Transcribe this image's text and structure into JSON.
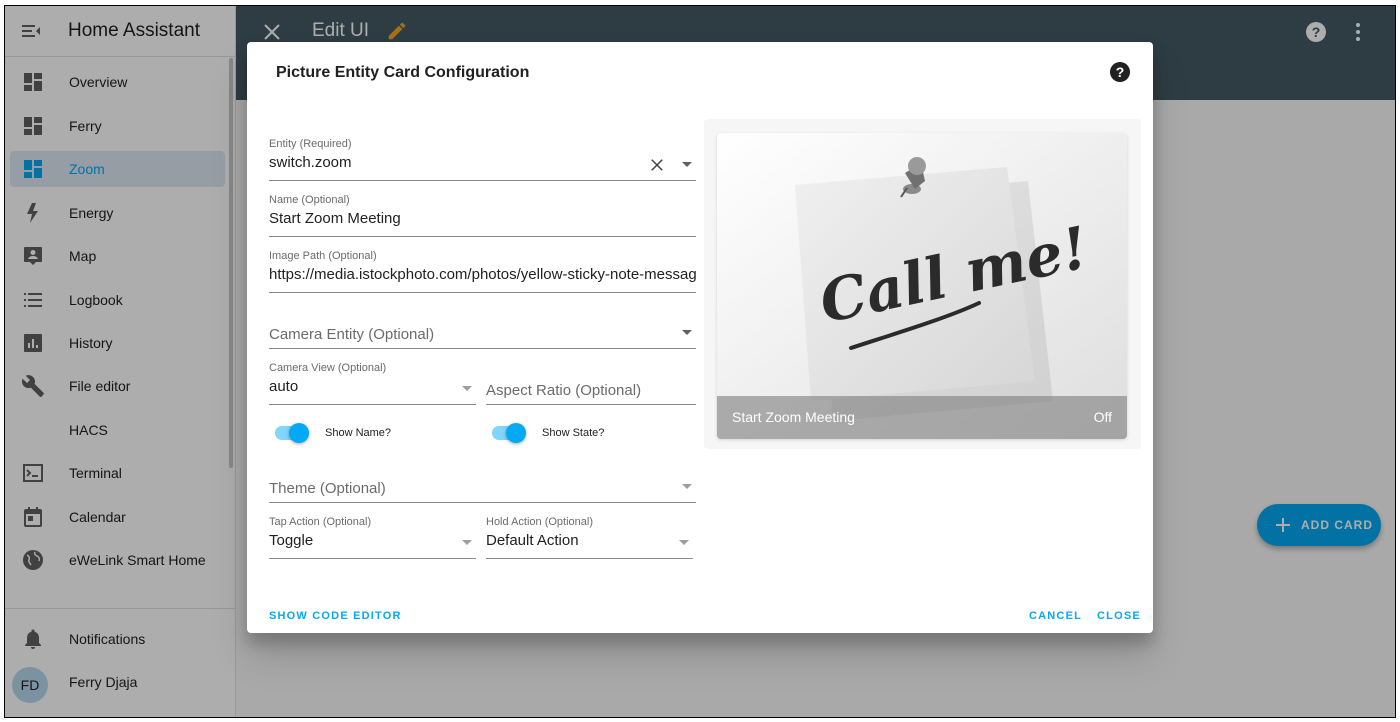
{
  "sidebar": {
    "title": "Home Assistant",
    "items": [
      {
        "label": "Overview",
        "icon": "overview-icon"
      },
      {
        "label": "Ferry",
        "icon": "dashboard-icon"
      },
      {
        "label": "Zoom",
        "icon": "dashboard-icon",
        "active": true
      },
      {
        "label": "Energy",
        "icon": "lightning-icon"
      },
      {
        "label": "Map",
        "icon": "map-account-icon"
      },
      {
        "label": "Logbook",
        "icon": "list-icon"
      },
      {
        "label": "History",
        "icon": "chart-icon"
      },
      {
        "label": "File editor",
        "icon": "wrench-icon"
      },
      {
        "label": "HACS",
        "icon": ""
      },
      {
        "label": "Terminal",
        "icon": "console-icon"
      },
      {
        "label": "Calendar",
        "icon": "calendar-icon"
      },
      {
        "label": "eWeLink Smart Home",
        "icon": "globe-icon"
      }
    ],
    "notifications_label": "Notifications",
    "user": {
      "initials": "FD",
      "name": "Ferry Djaja"
    }
  },
  "topbar": {
    "title": "Edit UI"
  },
  "add_card_label": "ADD CARD",
  "dialog": {
    "title": "Picture Entity Card Configuration",
    "entity": {
      "label": "Entity (Required)",
      "value": "switch.zoom"
    },
    "name": {
      "label": "Name (Optional)",
      "value": "Start Zoom Meeting"
    },
    "image_path": {
      "label": "Image Path (Optional)",
      "value": "https://media.istockphoto.com/photos/yellow-sticky-note-message"
    },
    "camera_entity": {
      "placeholder": "Camera Entity (Optional)"
    },
    "camera_view": {
      "label": "Camera View (Optional)",
      "value": "auto"
    },
    "aspect_ratio": {
      "placeholder": "Aspect Ratio (Optional)"
    },
    "show_name": {
      "label": "Show Name?",
      "checked": true
    },
    "show_state": {
      "label": "Show State?",
      "checked": true
    },
    "theme": {
      "placeholder": "Theme (Optional)"
    },
    "tap_action": {
      "label": "Tap Action (Optional)",
      "value": "Toggle"
    },
    "hold_action": {
      "label": "Hold Action (Optional)",
      "value": "Default Action"
    },
    "show_code_editor_label": "SHOW CODE EDITOR",
    "cancel_label": "CANCEL",
    "close_label": "CLOSE"
  },
  "preview": {
    "image_text": "Call me!",
    "name": "Start Zoom Meeting",
    "state": "Off"
  },
  "colors": {
    "accent": "#03a9f4",
    "header": "#455a64",
    "active_bg": "#dde8f3"
  }
}
